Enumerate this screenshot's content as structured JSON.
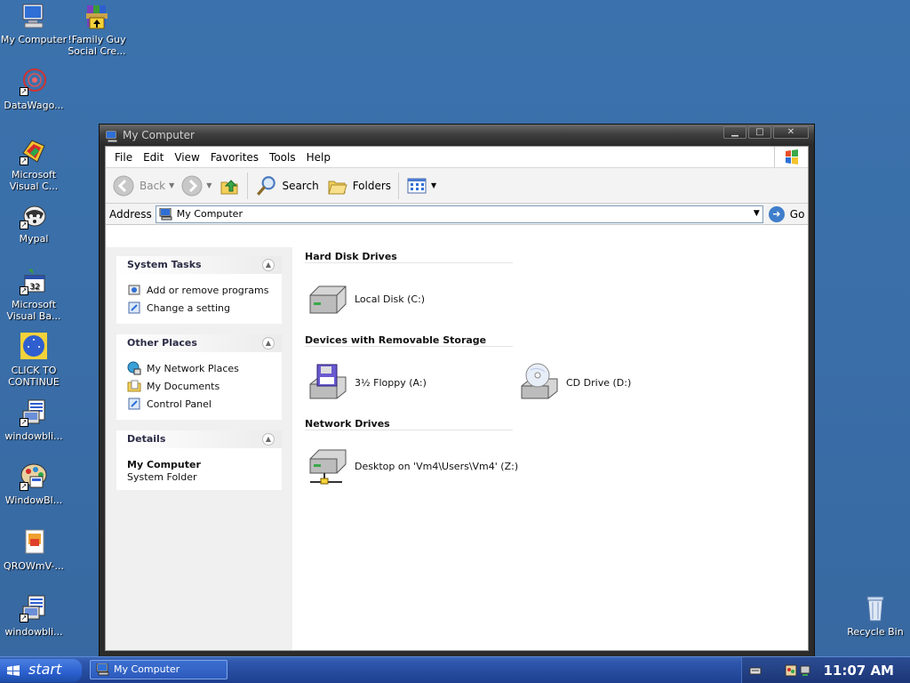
{
  "desktop": {
    "icons": [
      {
        "label": "My Computer",
        "icon": "my-computer-icon"
      },
      {
        "label": "!Family Guy Social Cre...",
        "icon": "winrar-archive-icon"
      },
      {
        "label": "DataWago...",
        "icon": "datawagon-icon"
      },
      {
        "label": "Microsoft Visual C...",
        "icon": "visual-c-icon"
      },
      {
        "label": "Mypal",
        "icon": "mypal-browser-icon"
      },
      {
        "label": "Microsoft Visual Ba...",
        "icon": "visual-basic-icon"
      },
      {
        "label": "CLICK TO CONTINUE",
        "icon": "click-to-continue-icon"
      },
      {
        "label": "windowbli...",
        "icon": "windowblinds-installer-icon"
      },
      {
        "label": "WindowBl...",
        "icon": "windowblinds-icon"
      },
      {
        "label": "QROWmV-...",
        "icon": "document-icon"
      },
      {
        "label": "windowbli...",
        "icon": "windowblinds-installer-icon"
      },
      {
        "label": "Recycle Bin",
        "icon": "recycle-bin-icon"
      }
    ]
  },
  "window": {
    "title": "My Computer",
    "menu": [
      "File",
      "Edit",
      "View",
      "Favorites",
      "Tools",
      "Help"
    ],
    "toolbar": {
      "back_label": "Back",
      "search_label": "Search",
      "folders_label": "Folders"
    },
    "address": {
      "label": "Address",
      "value": "My Computer",
      "go_label": "Go"
    },
    "taskpane": {
      "system_tasks": {
        "title": "System Tasks",
        "items": [
          "Add or remove programs",
          "Change a setting"
        ]
      },
      "other_places": {
        "title": "Other Places",
        "items": [
          "My Network Places",
          "My Documents",
          "Control Panel"
        ]
      },
      "details": {
        "title": "Details",
        "name": "My Computer",
        "type": "System Folder"
      }
    },
    "groups": {
      "hard_disks": {
        "title": "Hard Disk Drives",
        "items": [
          "Local Disk (C:)"
        ]
      },
      "removable": {
        "title": "Devices with Removable Storage",
        "items": [
          "3½ Floppy (A:)",
          "CD Drive (D:)"
        ]
      },
      "network": {
        "title": "Network Drives",
        "items": [
          "Desktop on 'Vm4\\Users\\Vm4' (Z:)"
        ]
      }
    }
  },
  "taskbar": {
    "start_label": "start",
    "task_label": "My Computer",
    "clock": "11:07 AM"
  },
  "colors": {
    "desktop": "#3a6ea5",
    "taskbar": "#2e57ad",
    "titlebar": "#3f3f3f"
  }
}
